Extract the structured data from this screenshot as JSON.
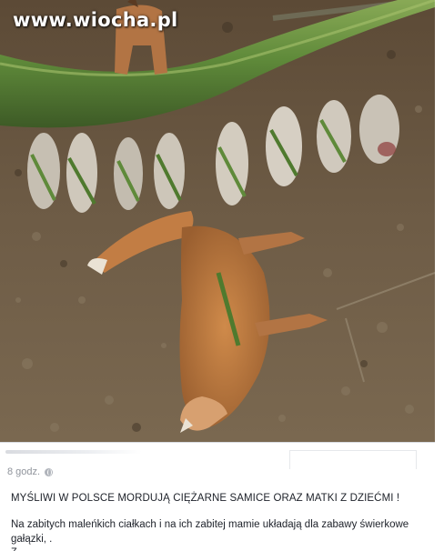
{
  "photo": {
    "watermark": "www.wiocha.pl",
    "colors": {
      "ground": "#6b5a44",
      "moss": "#5f8a3a",
      "fox": "#b7753e",
      "pelt": "#c9c3b8"
    }
  },
  "post": {
    "timestamp": "8 godz.",
    "visibility_icon": "globe-icon",
    "headline": "MYŚLIWI W POLSCE MORDUJĄ CIĘŻARNE SAMICE ORAZ MATKI Z DZIEĆMI !",
    "body": "Na zabitych maleńkich ciałkach i na ich zabitej mamie układają dla zabawy świerkowe gałązki, .",
    "body_cut": "Z..."
  }
}
